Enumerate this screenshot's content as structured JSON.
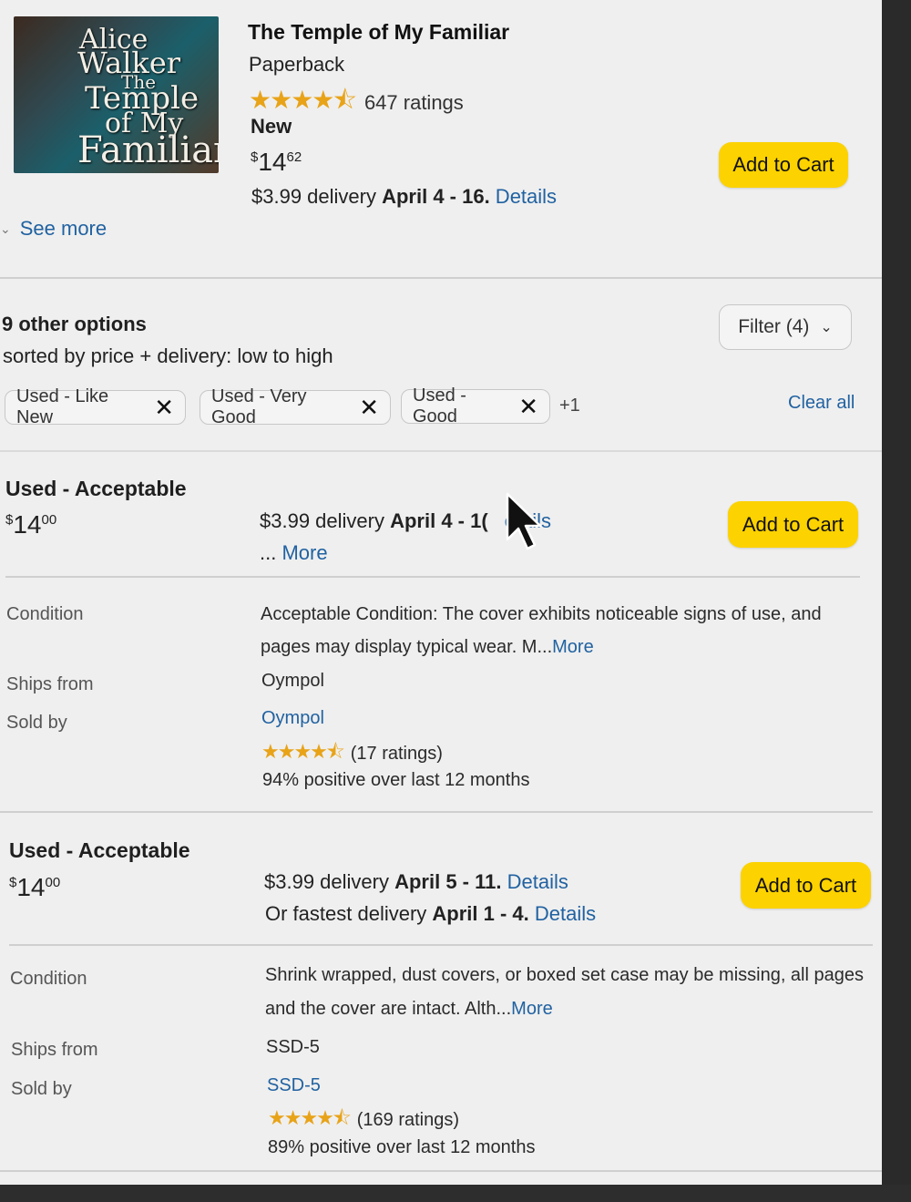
{
  "product": {
    "cover_lines": [
      "Alice",
      "Walker",
      "The",
      "Temple",
      "of My",
      "Familiar"
    ],
    "title": "The Temple of My Familiar",
    "format": "Paperback",
    "ratings": "647 ratings",
    "condition": "New",
    "price_symbol": "$",
    "price_whole": "14",
    "price_fraction": "62",
    "delivery_prefix": "$3.99 delivery ",
    "delivery_date": "April 4 - 16.",
    "delivery_link": " Details",
    "add_to_cart": "Add to Cart",
    "see_more": "See more",
    "star_icon": "star-rating-icon",
    "star_color": "#e8a318"
  },
  "options": {
    "heading": "9 other options",
    "sort_text": "sorted by price + delivery: low to high",
    "filter_label": "Filter (4)",
    "chips": [
      "Used - Like New",
      "Used - Very Good",
      "Used - Good"
    ],
    "chip_more": "+1",
    "clear_all": "Clear all"
  },
  "offers": [
    {
      "condition": "Used - Acceptable",
      "price_symbol": "$",
      "price_whole": "14",
      "price_fraction": "00",
      "delivery_prefix": "$3.99 delivery ",
      "delivery_date": "April 4 - 1(",
      "delivery_link": "etails",
      "line2_prefix": "... ",
      "line2_link": "More",
      "add_to_cart": "Add to Cart",
      "condition_label": "Condition",
      "condition_text_1": "Acceptable Condition: The cover exhibits noticeable signs of use, and",
      "condition_text_2": "pages may display typical wear. M...",
      "condition_more": "More",
      "ships_from_label": "Ships from",
      "ships_from": "Oympol",
      "sold_by_label": "Sold by",
      "sold_by": "Oympol",
      "seller_ratings": "(17 ratings)",
      "seller_positive": "94% positive over last 12 months"
    },
    {
      "condition": "Used - Acceptable",
      "price_symbol": "$",
      "price_whole": "14",
      "price_fraction": "00",
      "delivery_prefix": "$3.99 delivery ",
      "delivery_date": "April 5 - 11.",
      "delivery_link": " Details",
      "line2_prefix": "Or fastest delivery ",
      "line2_date": "April 1 - 4.",
      "line2_link": " Details",
      "add_to_cart": "Add to Cart",
      "condition_label": "Condition",
      "condition_text_1": "Shrink wrapped, dust covers, or boxed set case may be missing, all pages",
      "condition_text_2": "and the cover are intact. Alth...",
      "condition_more": "More",
      "ships_from_label": "Ships from",
      "ships_from": "SSD-5",
      "sold_by_label": "Sold by",
      "sold_by": "SSD-5",
      "seller_ratings": "(169 ratings)",
      "seller_positive": "89% positive over last 12 months"
    }
  ],
  "colors": {
    "link": "#2162a1",
    "button": "#fcd200",
    "background": "#efefef"
  }
}
